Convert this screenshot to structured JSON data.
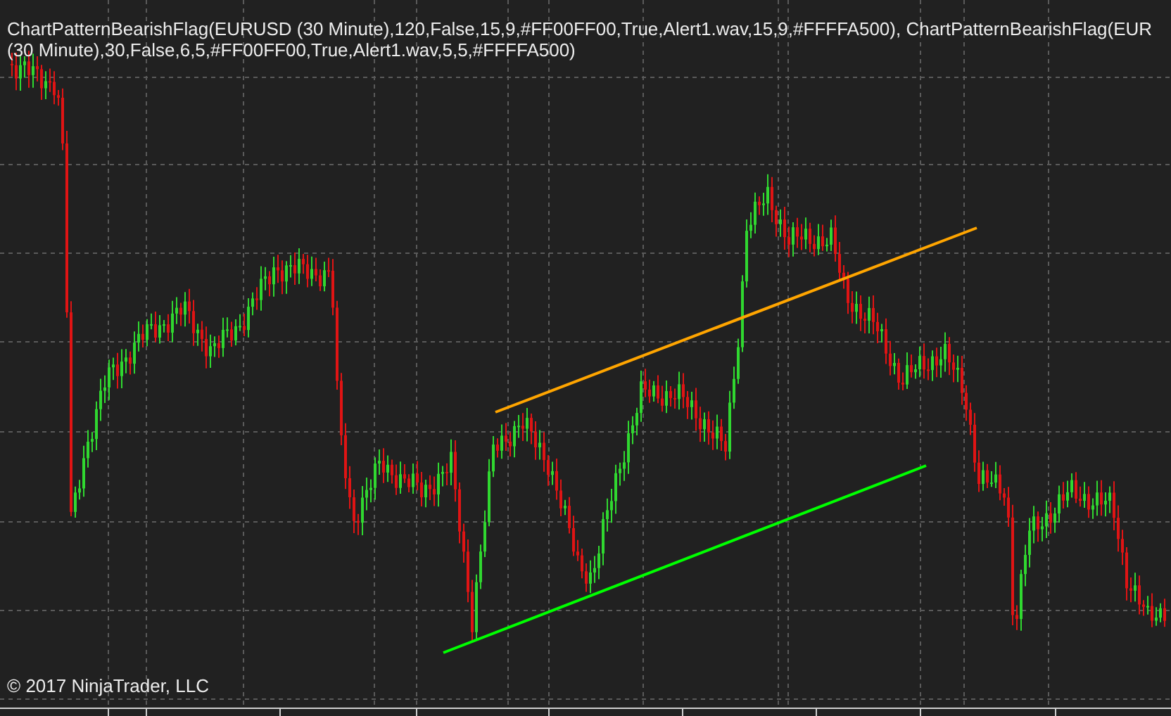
{
  "chart": {
    "indicator_label_lines": [
      "ChartPatternBearishFlag(EURUSD (30 Minute),120,False,15,9,#FF00FF00,True,Alert1.wav,15,9,#FFFFA500), ChartPatternBearishFlag(EUR",
      "(30 Minute),30,False,6,5,#FF00FF00,True,Alert1.wav,5,5,#FFFFA500)"
    ],
    "copyright": "© 2017 NinjaTrader, LLC"
  }
}
